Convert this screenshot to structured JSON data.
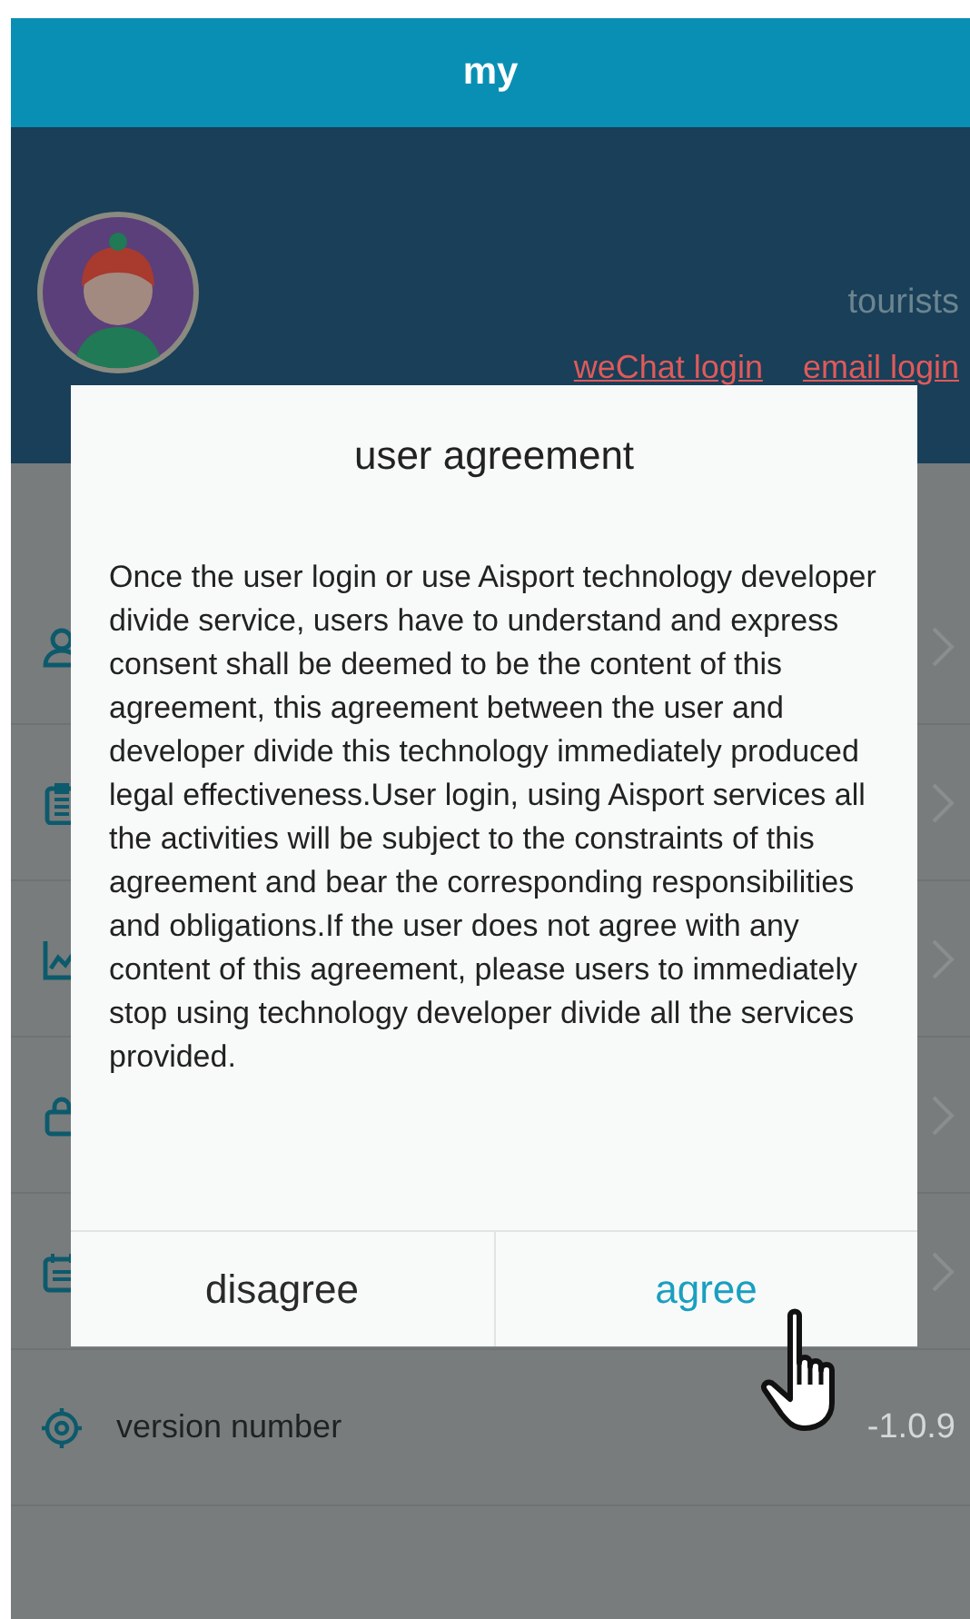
{
  "app_bar": {
    "title": "my"
  },
  "profile": {
    "status": "tourists",
    "login_links": [
      {
        "label": "weChat login"
      },
      {
        "label": "email login"
      }
    ]
  },
  "menu": {
    "items": [
      {
        "kind": "person"
      },
      {
        "kind": "clipboard"
      },
      {
        "kind": "chart"
      },
      {
        "kind": "lock"
      },
      {
        "kind": "calendar"
      },
      {
        "kind": "version",
        "label": "version number",
        "value": "-1.0.9"
      }
    ]
  },
  "dialog": {
    "title": "user agreement",
    "body": "Once the user login or use Aisport technology developer divide service, users have to understand and express consent shall be deemed to be the content of this agreement, this agreement between the user and developer divide this technology immediately produced legal effectiveness.User login, using Aisport services all the activities will be subject to the constraints of this agreement and bear the corresponding responsibilities and obligations.If the user does not agree with any content of this agreement, please users to immediately stop using technology developer divide all the services provided.",
    "buttons": [
      {
        "label": "disagree",
        "kind": "cancel"
      },
      {
        "label": "agree",
        "kind": "confirm"
      }
    ]
  }
}
